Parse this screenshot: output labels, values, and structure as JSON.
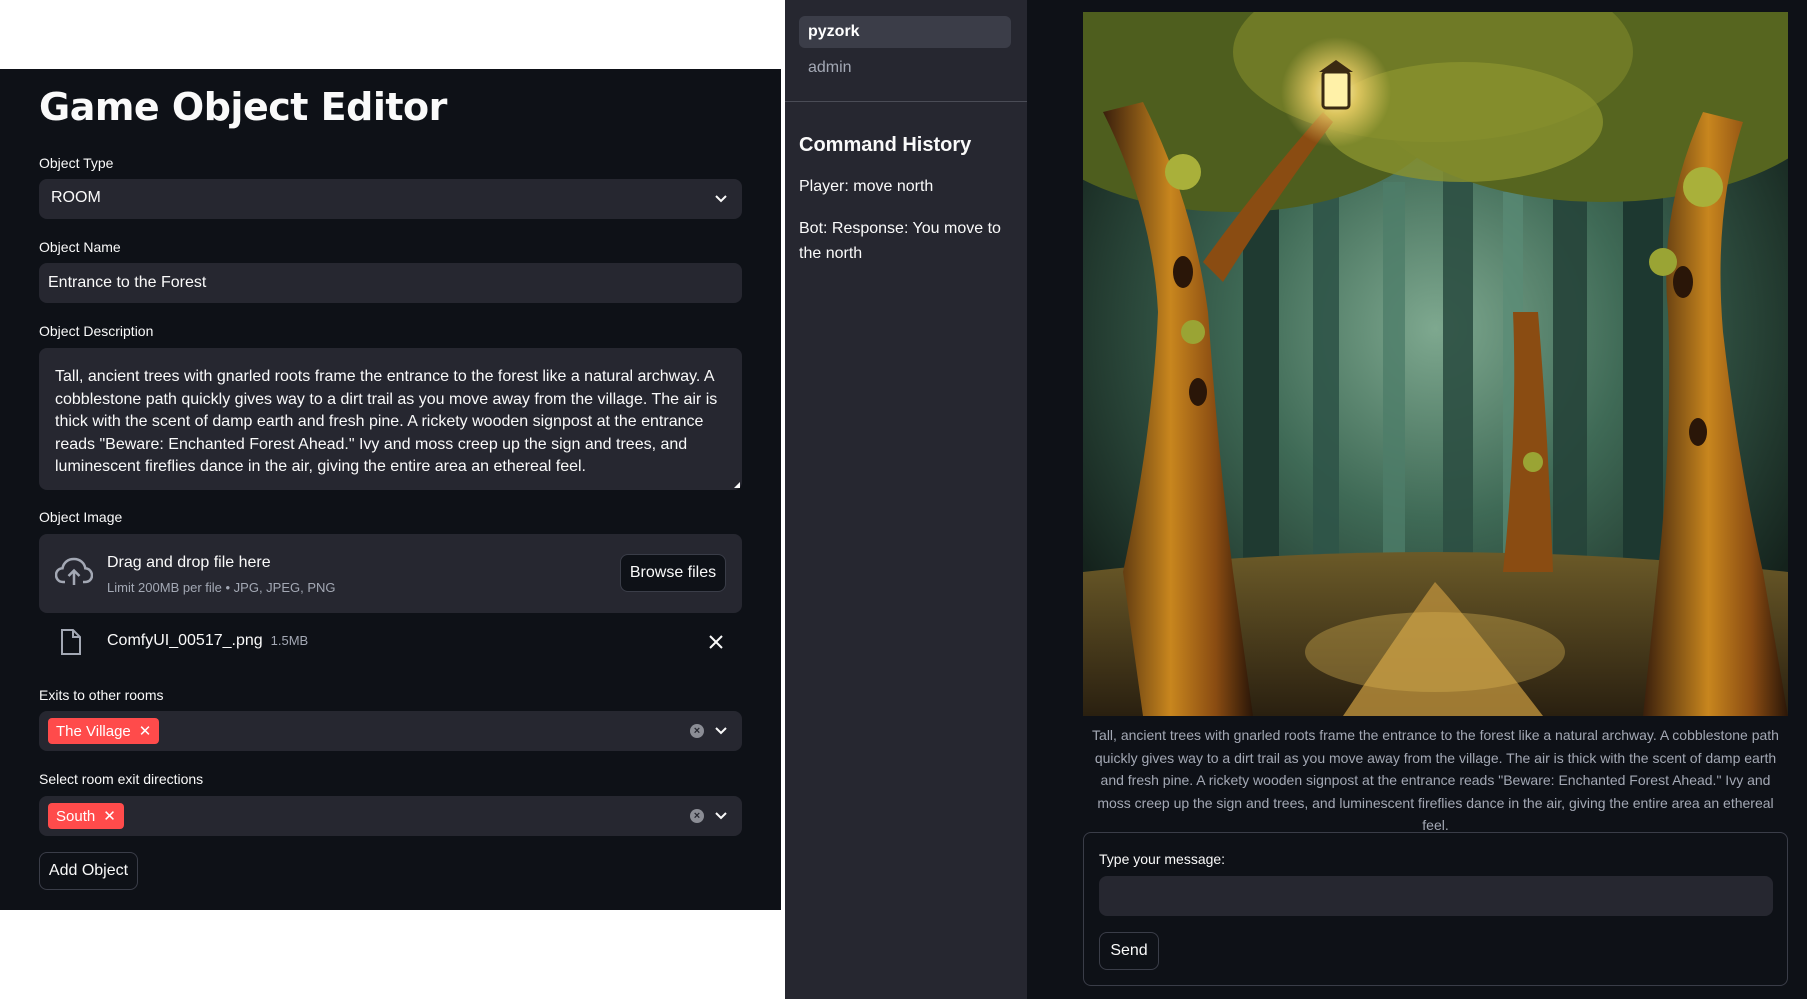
{
  "editor": {
    "title": "Game Object Editor",
    "object_type": {
      "label": "Object Type",
      "value": "ROOM"
    },
    "object_name": {
      "label": "Object Name",
      "value": "Entrance to the Forest"
    },
    "object_description": {
      "label": "Object Description",
      "value": "Tall, ancient trees with gnarled roots frame the entrance to the forest like a natural archway. A cobblestone path quickly gives way to a dirt trail as you move away from the village. The air is thick with the scent of damp earth and fresh pine. A rickety wooden signpost at the entrance reads \"Beware: Enchanted Forest Ahead.\" Ivy and moss creep up the sign and trees, and luminescent fireflies dance in the air, giving the entire area an ethereal feel."
    },
    "object_image": {
      "label": "Object Image",
      "drop_text": "Drag and drop file here",
      "limit_text": "Limit 200MB per file • JPG, JPEG, PNG",
      "browse_label": "Browse files",
      "file_name": "ComfyUI_00517_.png",
      "file_size": "1.5MB"
    },
    "exits": {
      "label": "Exits to other rooms",
      "tags": [
        "The Village"
      ]
    },
    "directions": {
      "label": "Select room exit directions",
      "tags": [
        "South"
      ]
    },
    "add_button": "Add Object"
  },
  "sidebar": {
    "pages": [
      "pyzork",
      "admin"
    ],
    "active_page": "pyzork",
    "history_title": "Command History",
    "history": [
      "Player: move north",
      "Bot: Response: You move to the north"
    ]
  },
  "main": {
    "caption": "Tall, ancient trees with gnarled roots frame the entrance to the forest like a natural archway. A cobblestone path quickly gives way to a dirt trail as you move away from the village. The air is thick with the scent of damp earth and fresh pine. A rickety wooden signpost at the entrance reads \"Beware: Enchanted Forest Ahead.\" Ivy and moss creep up the sign and trees, and luminescent fireflies dance in the air, giving the entire area an ethereal feel.",
    "message_label": "Type your message:",
    "message_value": "",
    "send_label": "Send"
  },
  "colors": {
    "background": "#0e1117",
    "sidebar": "#262730",
    "input": "#262730",
    "accent": "#ff4b4b"
  },
  "icons": [
    "chevron-down-icon",
    "cloud-upload-icon",
    "file-icon",
    "close-icon",
    "clear-icon"
  ]
}
